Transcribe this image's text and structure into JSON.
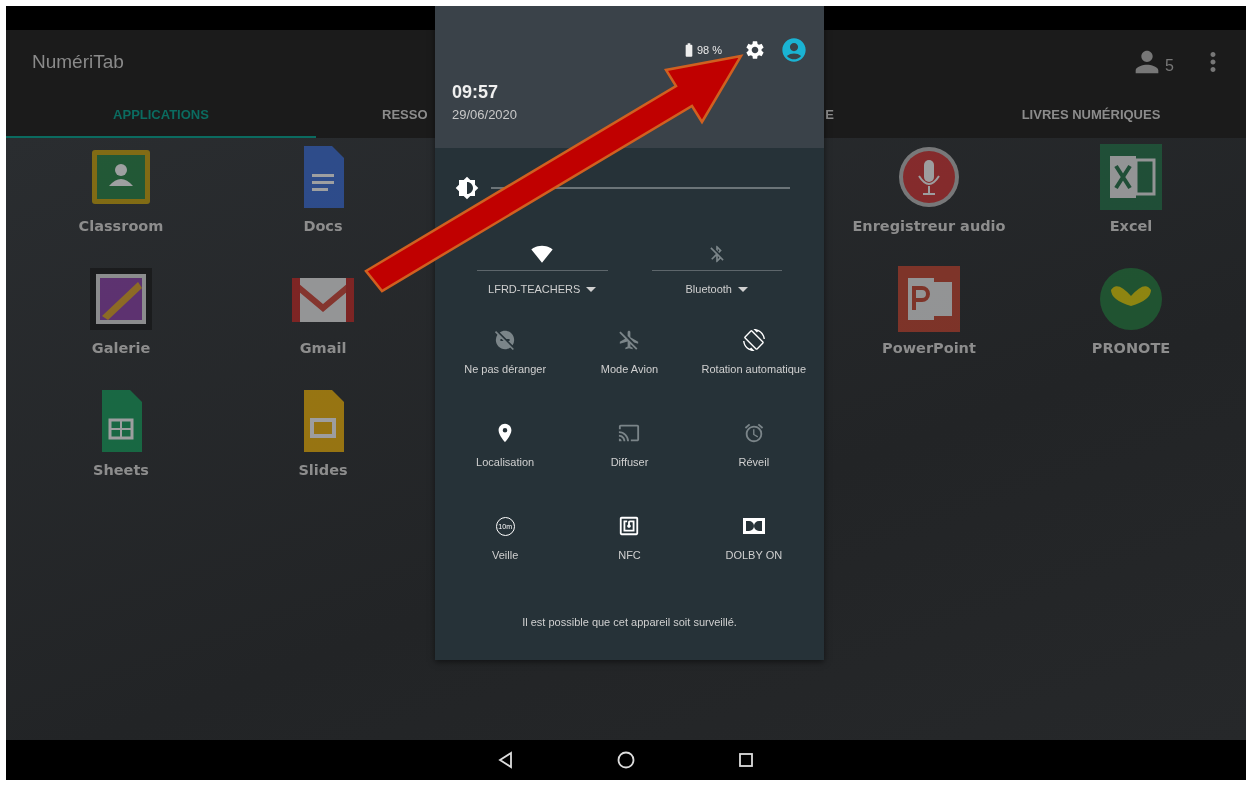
{
  "app_bar": {
    "title": "NumériTab",
    "user_count": "5"
  },
  "tabs": [
    {
      "label": "APPLICATIONS",
      "selected": true
    },
    {
      "label": "RESSO",
      "selected": false
    },
    {
      "label": "E",
      "selected": false
    },
    {
      "label": "LIVRES NUMÉRIQUES",
      "selected": false
    }
  ],
  "apps_left": [
    {
      "label": "Classroom"
    },
    {
      "label": "Docs"
    },
    {
      "label": "Galerie"
    },
    {
      "label": "Gmail"
    },
    {
      "label": "Sheets"
    },
    {
      "label": "Slides"
    }
  ],
  "apps_right": [
    {
      "label": "Enregistreur audio"
    },
    {
      "label": "Excel"
    },
    {
      "label": "PowerPoint"
    },
    {
      "label": "PRONOTE"
    }
  ],
  "quick_settings": {
    "battery": "98 %",
    "time": "09:57",
    "date": "29/06/2020",
    "network_tiles": [
      {
        "label": "LFRD-TEACHERS",
        "on": true
      },
      {
        "label": "Bluetooth",
        "on": false
      }
    ],
    "tiles": [
      {
        "label": "Ne pas déranger",
        "on": false
      },
      {
        "label": "Mode Avion",
        "on": false
      },
      {
        "label": "Rotation automatique",
        "on": true
      },
      {
        "label": "Localisation",
        "on": true
      },
      {
        "label": "Diffuser",
        "on": false
      },
      {
        "label": "Réveil",
        "on": false
      },
      {
        "label": "Veille",
        "on": true,
        "icon_text": "10m"
      },
      {
        "label": "NFC",
        "on": true
      },
      {
        "label": "DOLBY ON",
        "on": true
      }
    ],
    "footer": "Il est possible que cet appareil soit surveillé."
  }
}
